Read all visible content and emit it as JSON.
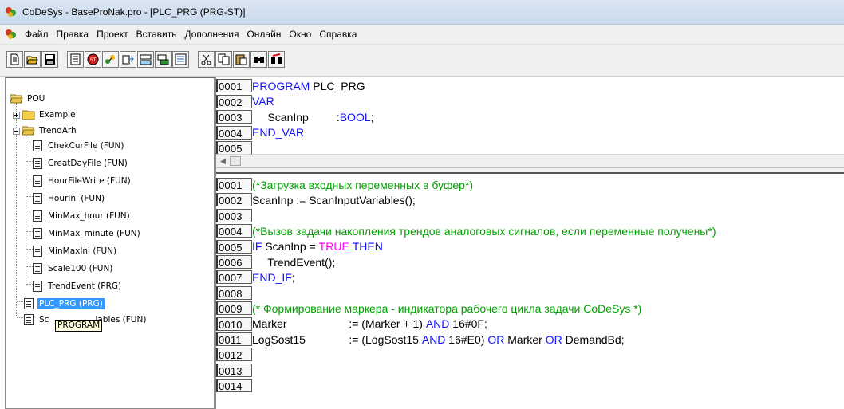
{
  "window": {
    "title": "CoDeSys - BaseProNak.pro - [PLC_PRG (PRG-ST)]"
  },
  "menu": {
    "items": [
      "Файл",
      "Правка",
      "Проект",
      "Вставить",
      "Дополнения",
      "Онлайн",
      "Окно",
      "Справка"
    ]
  },
  "toolbar": {
    "buttons": [
      "new-icon",
      "open-icon",
      "save-icon",
      "build-icon",
      "stop-icon",
      "login-icon",
      "logout-icon",
      "run-icon",
      "step-icon",
      "breakpoint-icon",
      "cut-icon",
      "copy-icon",
      "paste-icon",
      "find-icon",
      "replace-icon"
    ]
  },
  "tree": {
    "root": "POU",
    "folders": [
      {
        "label": "Example",
        "expanded": false
      },
      {
        "label": "TrendArh",
        "expanded": true
      }
    ],
    "trendarh_items": [
      "ChekCurFile (FUN)",
      "CreatDayFile (FUN)",
      "HourFileWrite (FUN)",
      "HourIni (FUN)",
      "MinMax_hour (FUN)",
      "MinMax_minute (FUN)",
      "MinMaxIni (FUN)",
      "Scale100 (FUN)",
      "TrendEvent (PRG)"
    ],
    "root_items": [
      "PLC_PRG (PRG)",
      "Sc",
      "iables (FUN)"
    ],
    "selected": "PLC_PRG (PRG)",
    "tooltip": "PROGRAM"
  },
  "declaration": {
    "lines": [
      {
        "no": "0001",
        "parts": [
          {
            "t": "PROGRAM",
            "c": "kw"
          },
          {
            "t": " PLC_PRG",
            "c": ""
          }
        ]
      },
      {
        "no": "0002",
        "parts": [
          {
            "t": "VAR",
            "c": "kw"
          }
        ]
      },
      {
        "no": "0003",
        "parts": [
          {
            "t": "     ScanInp         :",
            "c": ""
          },
          {
            "t": "BOOL",
            "c": "kw"
          },
          {
            "t": ";",
            "c": ""
          }
        ]
      },
      {
        "no": "0004",
        "parts": [
          {
            "t": "END_VAR",
            "c": "kw"
          }
        ]
      },
      {
        "no": "0005",
        "parts": []
      }
    ]
  },
  "body": {
    "lines": [
      {
        "no": "0001",
        "parts": [
          {
            "t": "(*Загрузка входных переменных в буфер*)",
            "c": "cmt"
          }
        ]
      },
      {
        "no": "0002",
        "parts": [
          {
            "t": "ScanInp := ScanInputVariables();",
            "c": ""
          }
        ]
      },
      {
        "no": "0003",
        "parts": []
      },
      {
        "no": "0004",
        "parts": [
          {
            "t": "(*Вызов задачи накопления трендов аналоговых сигналов, если переменные получены*)",
            "c": "cmt"
          }
        ]
      },
      {
        "no": "0005",
        "parts": [
          {
            "t": "IF",
            "c": "kw"
          },
          {
            "t": " ScanInp = ",
            "c": ""
          },
          {
            "t": "TRUE",
            "c": "lit"
          },
          {
            "t": " ",
            "c": ""
          },
          {
            "t": "THEN",
            "c": "kw"
          }
        ]
      },
      {
        "no": "0006",
        "parts": [
          {
            "t": "     TrendEvent();",
            "c": ""
          }
        ]
      },
      {
        "no": "0007",
        "parts": [
          {
            "t": "END_IF",
            "c": "kw"
          },
          {
            "t": ";",
            "c": ""
          }
        ]
      },
      {
        "no": "0008",
        "parts": []
      },
      {
        "no": "0009",
        "parts": [
          {
            "t": "(* Формирование маркера - индикатора рабочего цикла задачи CoDeSys *)",
            "c": "cmt"
          }
        ]
      },
      {
        "no": "0010",
        "parts": [
          {
            "t": "Marker                    := (Marker + 1) ",
            "c": ""
          },
          {
            "t": "AND",
            "c": "kw"
          },
          {
            "t": " 16#0F;",
            "c": ""
          }
        ]
      },
      {
        "no": "0011",
        "parts": [
          {
            "t": "LogSost15              := (LogSost15 ",
            "c": ""
          },
          {
            "t": "AND",
            "c": "kw"
          },
          {
            "t": " 16#E0) ",
            "c": ""
          },
          {
            "t": "OR",
            "c": "kw"
          },
          {
            "t": " Marker ",
            "c": ""
          },
          {
            "t": "OR",
            "c": "kw"
          },
          {
            "t": " DemandBd;",
            "c": ""
          }
        ]
      },
      {
        "no": "0012",
        "parts": []
      },
      {
        "no": "0013",
        "parts": []
      },
      {
        "no": "0014",
        "parts": []
      }
    ]
  }
}
